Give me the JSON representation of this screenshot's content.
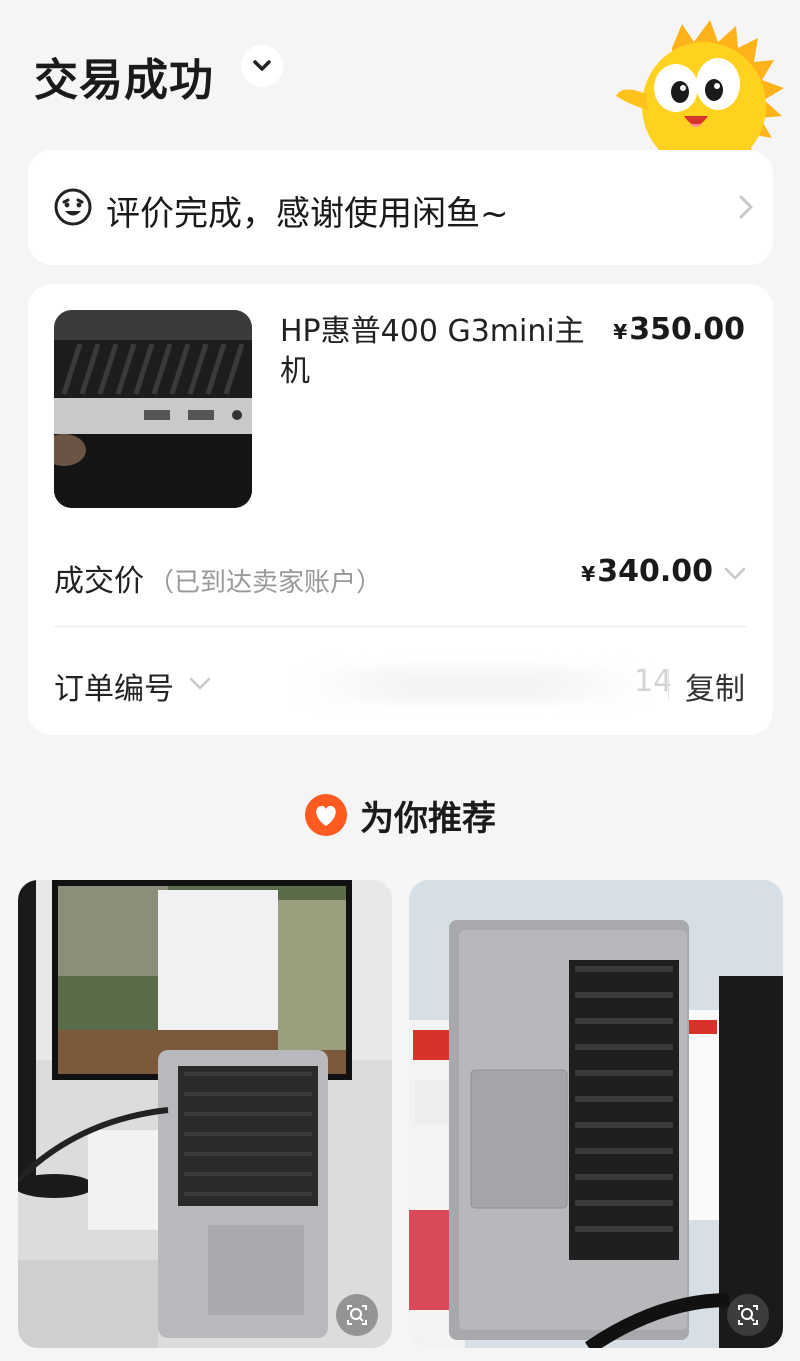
{
  "header": {
    "title": "交易成功",
    "title_dropdown_icon": "chevron-down-icon",
    "mascot_icon": "xianyu-fish-mascot"
  },
  "review": {
    "icon": "smiley-face-icon",
    "text": "评价完成，感谢使用闲鱼~",
    "arrow_icon": "chevron-right-icon"
  },
  "order": {
    "product_title": "HP惠普400 G3mini主机",
    "currency": "¥",
    "price": "350.00",
    "deal_label": "成交价",
    "deal_note": "（已到达卖家账户）",
    "deal_price": "340.00",
    "order_no_label": "订单编号",
    "order_no_visible_tail": "14",
    "copy_label": "复制"
  },
  "recommend": {
    "icon": "heart-icon",
    "title": "为你推荐",
    "items": [
      {
        "image": "macbook-air-photo",
        "zoom_icon": "zoom-search-icon"
      },
      {
        "image": "macbook-pro-keyboard-photo",
        "zoom_icon": "zoom-search-icon"
      }
    ]
  },
  "colors": {
    "background": "#f5f5f5",
    "card": "#ffffff",
    "accent_orange": "#ff5a1f",
    "mascot_yellow": "#ffd21f"
  }
}
